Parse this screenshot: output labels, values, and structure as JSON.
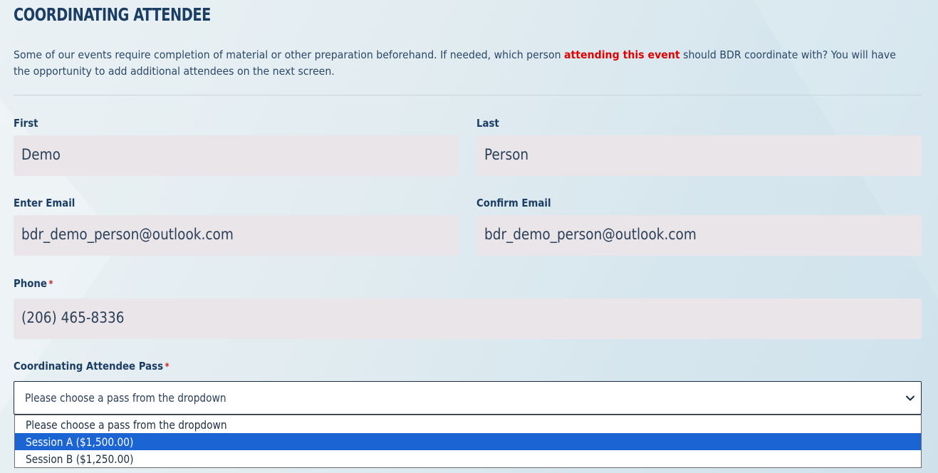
{
  "section": {
    "title": "COORDINATING ATTENDEE",
    "intro_before": "Some of our events require completion of material or other preparation beforehand. If needed, which person ",
    "intro_highlight": "attending this event",
    "intro_after": " should BDR coordinate with? You will have the opportunity to add additional attendees on the next screen."
  },
  "form": {
    "first": {
      "label": "First",
      "value": "Demo"
    },
    "last": {
      "label": "Last",
      "value": "Person"
    },
    "email": {
      "label": "Enter Email",
      "value": "bdr_demo_person@outlook.com"
    },
    "confirm_email": {
      "label": "Confirm Email",
      "value": "bdr_demo_person@outlook.com"
    },
    "phone": {
      "label": "Phone",
      "required_mark": "*",
      "value": "(206) 465-8336"
    },
    "pass": {
      "label": "Coordinating Attendee Pass",
      "required_mark": "*",
      "selected_value": "Please choose a pass from the dropdown",
      "options": [
        {
          "label": "Please choose a pass from the dropdown",
          "highlighted": false
        },
        {
          "label": "Session A ($1,500.00)",
          "highlighted": true
        },
        {
          "label": "Session B ($1,250.00)",
          "highlighted": false
        }
      ]
    }
  },
  "colors": {
    "heading": "#1c3d64",
    "highlight_red": "#e00000",
    "required_red": "#d21a1a",
    "field_bg": "#e9e5e8",
    "option_highlight": "#1a64d4"
  },
  "icons": {
    "select_arrow": "chevron-down-icon"
  }
}
